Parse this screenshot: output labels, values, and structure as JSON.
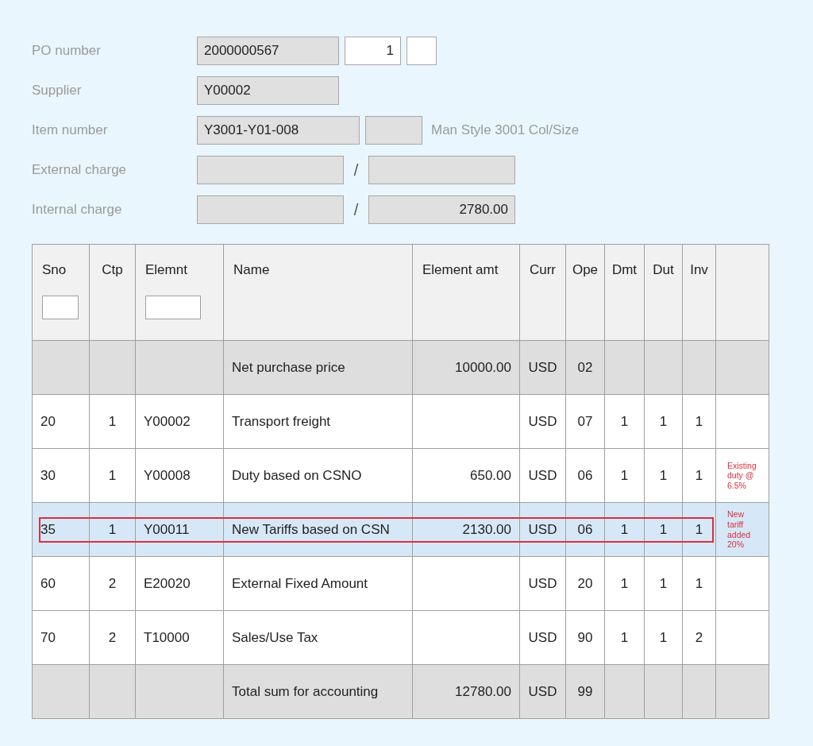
{
  "header_fields": [
    {
      "kind": "po",
      "label": "PO number",
      "fields": [
        {
          "kind": "display",
          "value": "2000000567"
        },
        {
          "kind": "input",
          "value": "1"
        },
        {
          "kind": "input_small"
        }
      ]
    },
    {
      "kind": "supplier",
      "label": "Supplier",
      "fields": [
        {
          "kind": "display",
          "value": "Y00002"
        }
      ]
    },
    {
      "kind": "item",
      "label": "Item number",
      "fields": [
        {
          "kind": "display",
          "value": "Y3001-Y01-008"
        },
        {
          "kind": "display_small"
        }
      ],
      "description": "Man Style 3001 Col/Size"
    },
    {
      "kind": "charge",
      "label": "External charge",
      "fields": [
        {
          "kind": "display"
        },
        {
          "kind": "display"
        }
      ],
      "separator": "/"
    },
    {
      "kind": "charge",
      "label": "Internal charge",
      "fields": [
        {
          "kind": "display"
        },
        {
          "kind": "display_amount",
          "value": "2780.00"
        }
      ],
      "separator": "/"
    }
  ],
  "table": {
    "columns": [
      {
        "label": "Sno",
        "filter": true
      },
      {
        "label": "Ctp",
        "filter": false
      },
      {
        "label": "Elemnt",
        "filter": true
      },
      {
        "label": "Name",
        "filter": false
      },
      {
        "label": "Element amt",
        "filter": false
      },
      {
        "label": "Curr",
        "filter": false
      },
      {
        "label": "Ope",
        "filter": false
      },
      {
        "label": "Dmt",
        "filter": false
      },
      {
        "label": "Dut",
        "filter": false
      },
      {
        "label": "Inv",
        "filter": false
      }
    ],
    "rows": [
      {
        "kind": "summary",
        "selected": false,
        "name": "Net purchase price",
        "element_amt": "10000.00",
        "curr": "USD",
        "ope": "02"
      },
      {
        "kind": "item",
        "selected": false,
        "sno": "20",
        "ctp": "1",
        "elemnt": "Y00002",
        "name": "Transport freight",
        "curr": "USD",
        "ope": "07",
        "dmt": "1",
        "dut": "1",
        "inv": "1"
      },
      {
        "kind": "item",
        "selected": false,
        "sno": "30",
        "ctp": "1",
        "elemnt": "Y00008",
        "name": "Duty based on CSNO",
        "element_amt": "650.00",
        "curr": "USD",
        "ope": "06",
        "dmt": "1",
        "dut": "1",
        "inv": "1",
        "note": "Existing duty @ 6.5%"
      },
      {
        "kind": "item",
        "selected": true,
        "sno": "35",
        "ctp": "1",
        "elemnt": "Y00011",
        "name": "New Tariffs based on CSN",
        "element_amt": "2130.00",
        "curr": "USD",
        "ope": "06",
        "dmt": "1",
        "dut": "1",
        "inv": "1",
        "note": "New tariff added 20%"
      },
      {
        "kind": "item",
        "selected": false,
        "sno": "60",
        "ctp": "2",
        "elemnt": "E20020",
        "name": "External Fixed Amount",
        "curr": "USD",
        "ope": "20",
        "dmt": "1",
        "dut": "1",
        "inv": "1"
      },
      {
        "kind": "item",
        "selected": false,
        "sno": "70",
        "ctp": "2",
        "elemnt": "T10000",
        "name": "Sales/Use Tax",
        "curr": "USD",
        "ope": "90",
        "dmt": "1",
        "dut": "1",
        "inv": "2"
      },
      {
        "kind": "summary",
        "selected": false,
        "name": "Total sum for accounting",
        "element_amt": "12780.00",
        "curr": "USD",
        "ope": "99"
      }
    ]
  }
}
